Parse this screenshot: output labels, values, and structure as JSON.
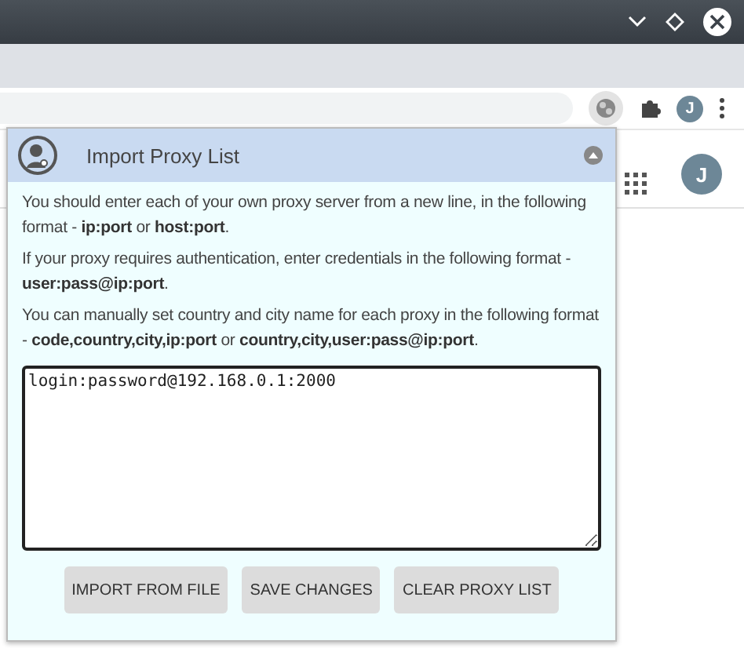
{
  "toolbar": {
    "avatar": "J"
  },
  "page": {
    "avatar": "J"
  },
  "popup": {
    "title": "Import Proxy List",
    "paragraphs": [
      "You should enter each of your own proxy server from a new line, in the following format - **ip:port** or **host:port**.",
      "If your proxy requires authentication, enter credentials in the following format - **user:pass@ip:port**.",
      "You can manually set country and city name for each proxy in the following format - **code,country,city,ip:port** or **country,city,user:pass@ip:port**."
    ],
    "proxy_list": "login:password@192.168.0.1:2000",
    "buttons": [
      "IMPORT FROM FILE",
      "SAVE CHANGES",
      "CLEAR PROXY LIST"
    ]
  }
}
